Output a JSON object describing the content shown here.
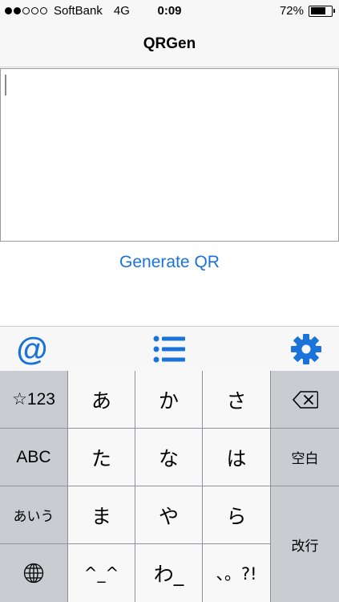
{
  "status_bar": {
    "signal_bars_filled": 2,
    "signal_bars_total": 5,
    "carrier": "SoftBank",
    "network": "4G",
    "time": "0:09",
    "battery_percent": "72%",
    "battery_level": 0.72
  },
  "nav": {
    "title": "QRGen"
  },
  "editor": {
    "value": ""
  },
  "actions": {
    "generate_label": "Generate QR"
  },
  "toolbar": {
    "at_symbol": "@",
    "list_icon": "list-icon",
    "settings_icon": "gear-icon"
  },
  "keyboard": {
    "row1": {
      "mode": "☆123",
      "k1": "あ",
      "k2": "か",
      "k3": "さ",
      "delete_icon": "backspace-icon"
    },
    "row2": {
      "mode": "ABC",
      "k1": "た",
      "k2": "な",
      "k3": "は",
      "space": "空白"
    },
    "row3": {
      "mode": "あいう",
      "k1": "ま",
      "k2": "や",
      "k3": "ら",
      "return": "改行"
    },
    "row4": {
      "globe_icon": "globe-icon",
      "k1": "^_^",
      "k2": "わ_",
      "k3": "、。?!"
    }
  },
  "colors": {
    "accent": "#1a73d9",
    "key_light": "#f8f8f8",
    "key_gray": "#c9cdd2"
  }
}
